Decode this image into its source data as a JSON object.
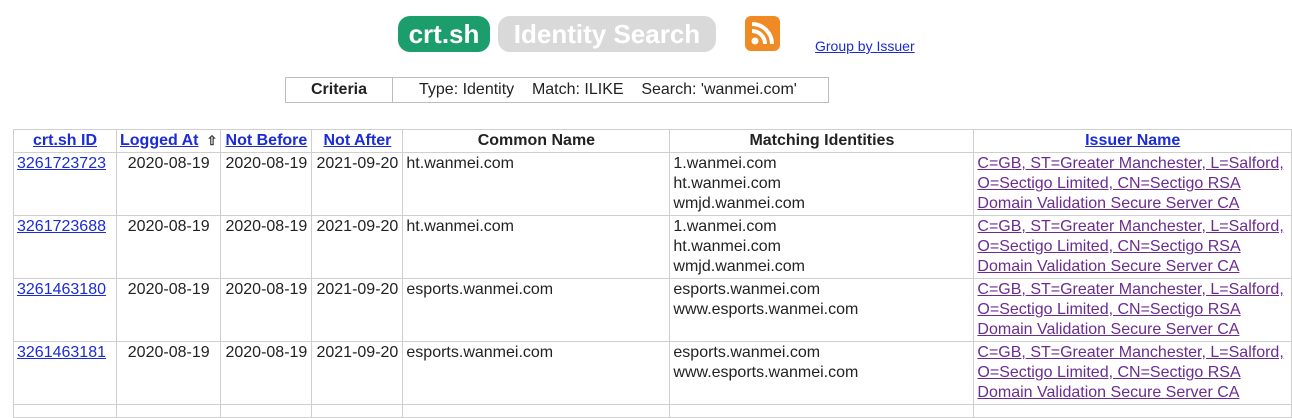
{
  "header": {
    "logo_text": "crt.sh",
    "subtitle": "Identity Search",
    "group_link": "Group by Issuer"
  },
  "criteria": {
    "label": "Criteria",
    "value": "Type: Identity    Match: ILIKE    Search: 'wanmei.com'"
  },
  "table": {
    "columns": [
      "crt.sh ID",
      "Logged At",
      "Not Before",
      "Not After",
      "Common Name",
      "Matching Identities",
      "Issuer Name"
    ],
    "sort_icon": "⇧",
    "rows": [
      {
        "id": "3261723723",
        "logged": "2020-08-19",
        "not_before": "2020-08-19",
        "not_after": "2021-09-20",
        "common_name": "ht.wanmei.com",
        "identities": [
          "1.wanmei.com",
          "ht.wanmei.com",
          "wmjd.wanmei.com"
        ],
        "issuer": [
          "C=GB, ST=Greater Manchester, L=Salford,",
          "O=Sectigo Limited, CN=Sectigo RSA",
          "Domain Validation Secure Server CA"
        ]
      },
      {
        "id": "3261723688",
        "logged": "2020-08-19",
        "not_before": "2020-08-19",
        "not_after": "2021-09-20",
        "common_name": "ht.wanmei.com",
        "identities": [
          "1.wanmei.com",
          "ht.wanmei.com",
          "wmjd.wanmei.com"
        ],
        "issuer": [
          "C=GB, ST=Greater Manchester, L=Salford,",
          "O=Sectigo Limited, CN=Sectigo RSA",
          "Domain Validation Secure Server CA"
        ]
      },
      {
        "id": "3261463180",
        "logged": "2020-08-19",
        "not_before": "2020-08-19",
        "not_after": "2021-09-20",
        "common_name": "esports.wanmei.com",
        "identities": [
          "esports.wanmei.com",
          "www.esports.wanmei.com"
        ],
        "issuer": [
          "C=GB, ST=Greater Manchester, L=Salford,",
          "O=Sectigo Limited, CN=Sectigo RSA",
          "Domain Validation Secure Server CA"
        ]
      },
      {
        "id": "3261463181",
        "logged": "2020-08-19",
        "not_before": "2020-08-19",
        "not_after": "2021-09-20",
        "common_name": "esports.wanmei.com",
        "identities": [
          "esports.wanmei.com",
          "www.esports.wanmei.com"
        ],
        "issuer": [
          "C=GB, ST=Greater Manchester, L=Salford,",
          "O=Sectigo Limited, CN=Sectigo RSA",
          "Domain Validation Secure Server CA"
        ]
      }
    ]
  },
  "colors": {
    "logo_green": "#1b9e6b",
    "logo_grey": "#d9d9d9",
    "rss_orange": "#f08a24",
    "link_blue": "#1b2bd6",
    "link_visited": "#6b2c91"
  },
  "icons": [
    "rss-feed-icon",
    "sort-up-icon"
  ]
}
